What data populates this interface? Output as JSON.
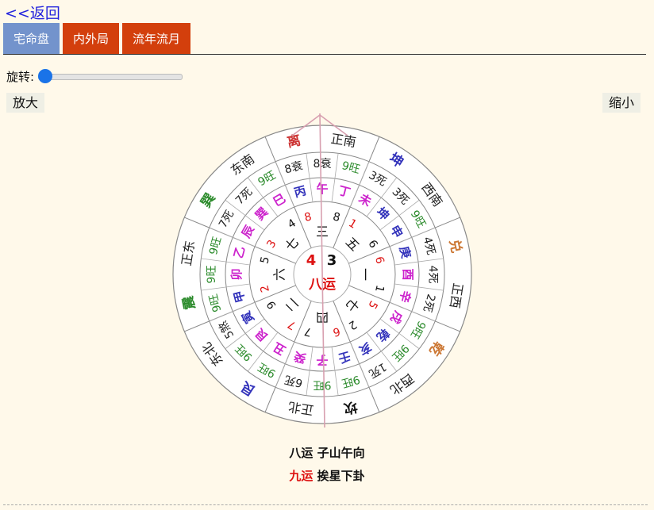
{
  "nav": {
    "back_label": "<<返回"
  },
  "tabs": [
    {
      "label": "宅命盘",
      "active": true
    },
    {
      "label": "内外局",
      "active": false
    },
    {
      "label": "流年流月",
      "active": false
    }
  ],
  "controls": {
    "rotate_label": "旋转:",
    "rotate_value": 0,
    "zoom_in_label": "放大",
    "zoom_out_label": "缩小"
  },
  "colors": {
    "accent": "#7393cc",
    "tab_red": "#d33f0c",
    "green": "#2a8a2a",
    "blue": "#3333bb",
    "magenta": "#cc22cc",
    "red": "#dd1111",
    "orange": "#cc7733"
  },
  "chart": {
    "directions": [
      {
        "gua": "离",
        "dir": "正南"
      },
      {
        "gua": "坤",
        "dir": "西南"
      },
      {
        "gua": "兑",
        "dir": "正西"
      },
      {
        "gua": "乾",
        "dir": "西北"
      },
      {
        "gua": "坎",
        "dir": "正北"
      },
      {
        "gua": "艮",
        "dir": "东北"
      },
      {
        "gua": "震",
        "dir": "正东"
      },
      {
        "gua": "巽",
        "dir": "东南"
      }
    ],
    "states": [
      "8衰",
      "8衰",
      "9旺",
      "3死",
      "3死",
      "9旺",
      "4死",
      "4死",
      "2死",
      "9旺",
      "9旺",
      "1死",
      "9旺",
      "9旺",
      "6死",
      "9旺",
      "9旺",
      "5煞",
      "9旺",
      "9旺",
      "9旺",
      "7死",
      "7死",
      "9旺"
    ],
    "mountains": [
      "丙",
      "午",
      "丁",
      "未",
      "坤",
      "申",
      "庚",
      "酉",
      "辛",
      "戌",
      "乾",
      "亥",
      "壬",
      "子",
      "癸",
      "丑",
      "艮",
      "寅",
      "甲",
      "卯",
      "乙",
      "辰",
      "巽",
      "巳"
    ],
    "palaces": [
      {
        "mountain": "8",
        "water": "8",
        "base": "三"
      },
      {
        "mountain": "1",
        "water": "6",
        "base": "五"
      },
      {
        "mountain": "6",
        "water": "1",
        "base": "一"
      },
      {
        "mountain": "5",
        "water": "2",
        "base": "七"
      },
      {
        "mountain": "6",
        "water": "7",
        "base": "四"
      },
      {
        "mountain": "7",
        "water": "9",
        "base": "二"
      },
      {
        "mountain": "2",
        "water": "5",
        "base": "六"
      },
      {
        "mountain": "3",
        "water": "4",
        "base": "七"
      }
    ],
    "center": {
      "mountain": "4",
      "water": "3",
      "yun": "八运"
    }
  },
  "captions": {
    "line1": "八运 子山午向",
    "line2_red": "九运",
    "line2": "挨星下卦"
  }
}
